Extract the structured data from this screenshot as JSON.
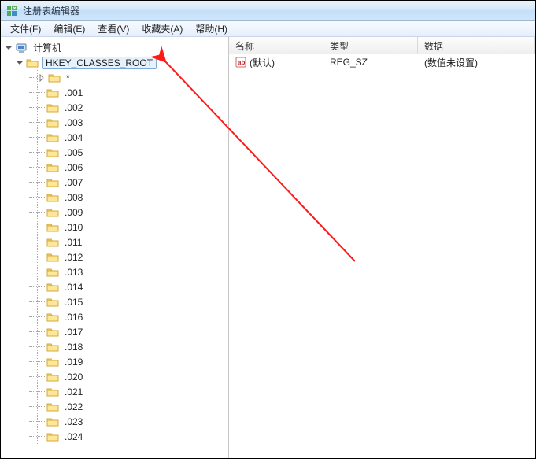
{
  "window": {
    "title": "注册表编辑器"
  },
  "menu": {
    "file": "文件(F)",
    "edit": "编辑(E)",
    "view": "查看(V)",
    "favorites": "收藏夹(A)",
    "help": "帮助(H)"
  },
  "tree": {
    "root": {
      "label": "计算机"
    },
    "selected": {
      "label": "HKEY_CLASSES_ROOT"
    },
    "star": {
      "label": "*"
    },
    "children": [
      ".001",
      ".002",
      ".003",
      ".004",
      ".005",
      ".006",
      ".007",
      ".008",
      ".009",
      ".010",
      ".011",
      ".012",
      ".013",
      ".014",
      ".015",
      ".016",
      ".017",
      ".018",
      ".019",
      ".020",
      ".021",
      ".022",
      ".023",
      ".024"
    ]
  },
  "list": {
    "columns": {
      "name": "名称",
      "type": "类型",
      "data": "数据"
    },
    "rows": [
      {
        "name": "(默认)",
        "type": "REG_SZ",
        "data": "(数值未设置)"
      }
    ]
  },
  "icons": {
    "app": "registry-icon",
    "computer": "computer-icon",
    "folder": "folder-icon",
    "string": "string-value-icon"
  }
}
